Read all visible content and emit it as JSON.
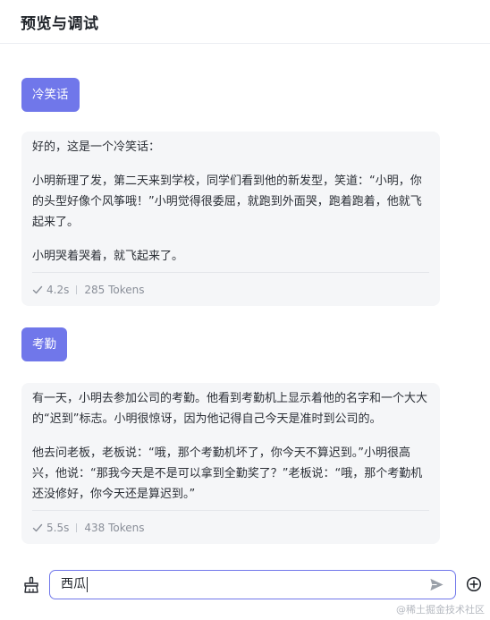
{
  "header": {
    "title": "预览与调试"
  },
  "messages": [
    {
      "user": "冷笑话",
      "reply": [
        "好的，这是一个冷笑话：",
        "小明新理了发，第二天来到学校，同学们看到他的新发型，笑道：“小明，你的头型好像个风筝哦！”小明觉得很委屈，就跑到外面哭，跑着跑着，他就飞起来了。",
        "小明哭着哭着，就飞起来了。"
      ],
      "time": "4.2s",
      "tokens": "285 Tokens"
    },
    {
      "user": "考勤",
      "reply": [
        "有一天，小明去参加公司的考勤。他看到考勤机上显示着他的名字和一个大大的“迟到”标志。小明很惊讶，因为他记得自己今天是准时到公司的。",
        "他去问老板，老板说：“哦，那个考勤机坏了，你今天不算迟到。”小明很高兴，他说：“那我今天是不是可以拿到全勤奖了？”老板说：“哦，那个考勤机还没修好，你今天还是算迟到。”"
      ],
      "time": "5.5s",
      "tokens": "438 Tokens"
    }
  ],
  "input": {
    "value": "西瓜"
  },
  "watermark": "@稀土掘金技术社区",
  "colors": {
    "accent": "#7077ea",
    "card_bg": "#f5f6f8",
    "meta_text": "#8a8f99"
  },
  "icons": {
    "clear": "broom-icon",
    "send": "send-icon",
    "new": "plus-circle-icon",
    "done": "check-icon"
  }
}
